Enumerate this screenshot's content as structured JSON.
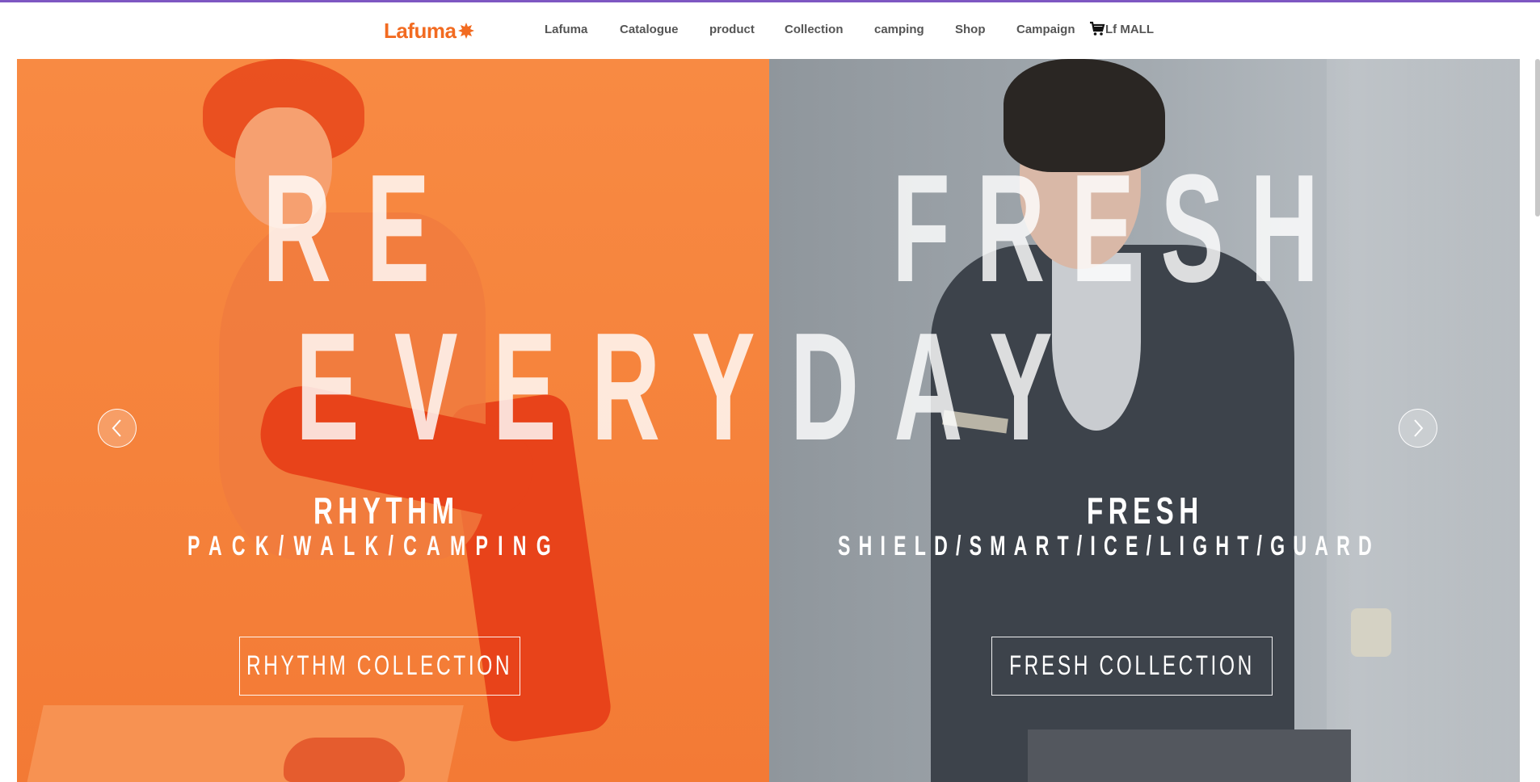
{
  "header": {
    "logo_text": "Lafuma",
    "nav": [
      {
        "label": "Lafuma"
      },
      {
        "label": "Catalogue"
      },
      {
        "label": "product"
      },
      {
        "label": "Collection"
      },
      {
        "label": "camping"
      },
      {
        "label": "Shop"
      },
      {
        "label": "Campaign"
      }
    ],
    "mall_label": "Lf MALL",
    "mall_icon": "cart-icon"
  },
  "hero": {
    "headline_top_left": "RE",
    "headline_top_right": "FRESH",
    "headline_bottom": "EVERYDAY",
    "left": {
      "title": "RHYTHM",
      "subtitle": "PACK/WALK/CAMPING",
      "button_label": "RHYTHM COLLECTION"
    },
    "right": {
      "title": "FRESH",
      "subtitle": "SHIELD/SMART/ICE/LIGHT/GUARD",
      "button_label": "FRESH COLLECTION"
    },
    "prev_icon": "chevron-left-icon",
    "next_icon": "chevron-right-icon"
  },
  "colors": {
    "accent_top_bar": "#7e57c2",
    "brand": "#f26b21",
    "left_panel": "#f5823b",
    "right_panel": "#a3aab0",
    "nav_text": "#555555"
  }
}
